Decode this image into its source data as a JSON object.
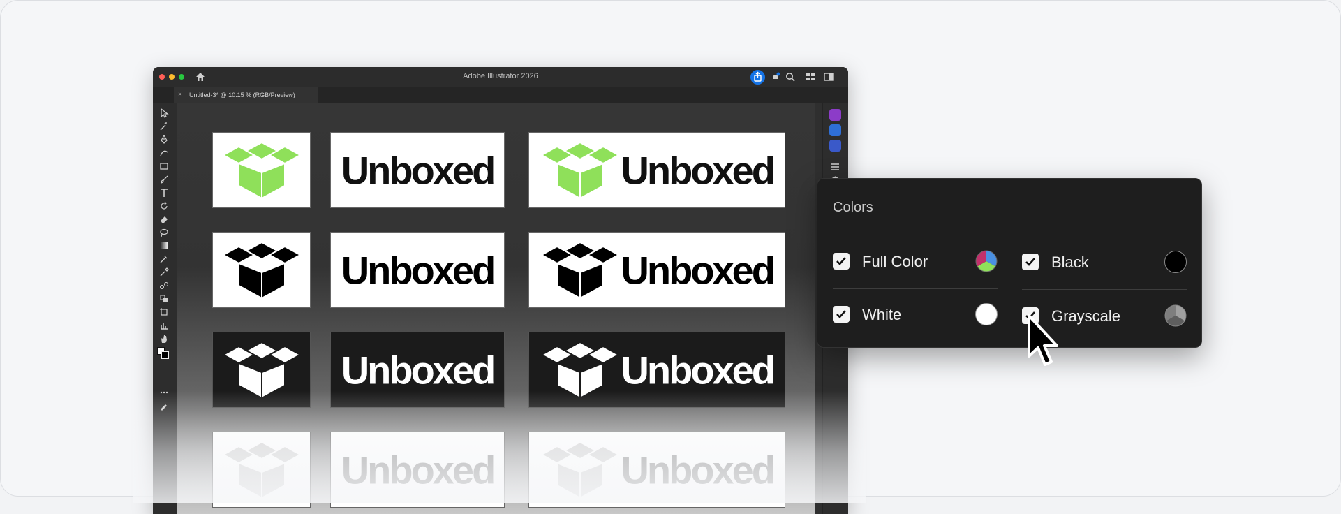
{
  "app": {
    "window_title": "Adobe Illustrator 2026",
    "document_tab": "Untitled-3* @ 10.15 % (RGB/Preview)",
    "tab_close": "×"
  },
  "artboards": {
    "wordmark": "Unboxed",
    "rows": [
      {
        "variant": "full-color",
        "bg": "#ffffff",
        "icon_color": "#8fe05a",
        "text_color": "#111111"
      },
      {
        "variant": "black",
        "bg": "#ffffff",
        "icon_color": "#000000",
        "text_color": "#000000"
      },
      {
        "variant": "white",
        "bg": "#1b1b1b",
        "icon_color": "#ffffff",
        "text_color": "#ffffff"
      },
      {
        "variant": "grayscale",
        "bg": "#ffffff",
        "icon_color": "#d4d4d4",
        "text_color": "#8c8c8c"
      }
    ]
  },
  "colors_panel": {
    "title": "Colors",
    "options": [
      {
        "label": "Full Color",
        "checked": true,
        "swatch": "tricolor"
      },
      {
        "label": "Black",
        "checked": true,
        "swatch": "#000000"
      },
      {
        "label": "White",
        "checked": true,
        "swatch": "#ffffff"
      },
      {
        "label": "Grayscale",
        "checked": true,
        "swatch": "gray-tri"
      }
    ]
  }
}
